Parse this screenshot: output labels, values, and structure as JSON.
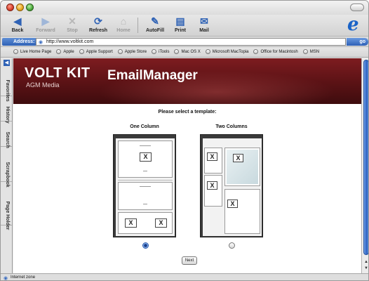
{
  "toolbar": {
    "back": "Back",
    "forward": "Forward",
    "stop": "Stop",
    "refresh": "Refresh",
    "home": "Home",
    "autofill": "AutoFill",
    "print": "Print",
    "mail": "Mail"
  },
  "address": {
    "label": "Address:",
    "url": "http://www.voltkit.com",
    "go": "go"
  },
  "favorites": [
    "Live Home Page",
    "Apple",
    "Apple Support",
    "Apple Store",
    "iTools",
    "Mac OS X",
    "Microsoft MacTopia",
    "Office for Macintosh",
    "MSN"
  ],
  "sidebar": {
    "tabs": [
      "Favorites",
      "History",
      "Search",
      "Scrapbook",
      "Page Holder"
    ]
  },
  "banner": {
    "brand": "VOLT KIT",
    "brand_sub": "AGM Media",
    "app_title": "EmailManager"
  },
  "main": {
    "prompt": "Please select a template:",
    "templates": [
      {
        "label": "One Column",
        "selected": true
      },
      {
        "label": "Two Columns",
        "selected": false
      }
    ],
    "placeholder_mark": "X",
    "next_label": "Next"
  },
  "status": {
    "text": "Internet zone"
  },
  "colors": {
    "banner": "#5a1215",
    "accent_blue": "#2f62b5"
  }
}
